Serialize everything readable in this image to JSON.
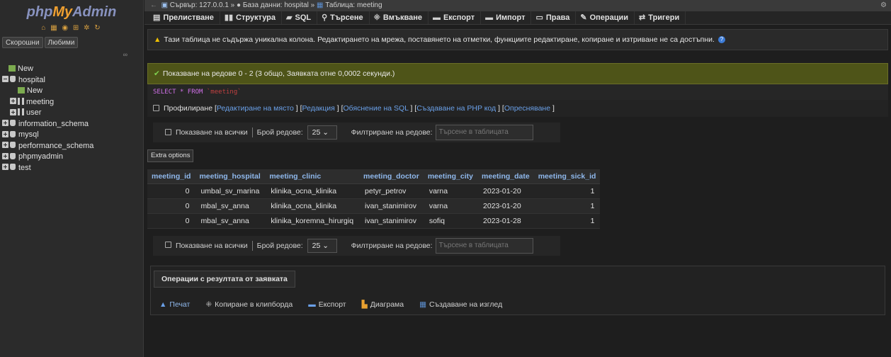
{
  "app": {
    "logo_php": "php",
    "logo_my": "My",
    "logo_admin": "Admin",
    "logo_icons": "⌂ ▦ ◉ ⊞ ✲ ↻"
  },
  "sidebar": {
    "tabs": [
      "Скорошни",
      "Любими"
    ],
    "link_icon": "∞",
    "tree": [
      {
        "label": "New",
        "level": 0,
        "type": "new"
      },
      {
        "label": "hospital",
        "level": 0,
        "type": "db",
        "expanded": true
      },
      {
        "label": "New",
        "level": 1,
        "type": "new"
      },
      {
        "label": "meeting",
        "level": 1,
        "type": "table"
      },
      {
        "label": "user",
        "level": 1,
        "type": "table"
      },
      {
        "label": "information_schema",
        "level": 0,
        "type": "db"
      },
      {
        "label": "mysql",
        "level": 0,
        "type": "db"
      },
      {
        "label": "performance_schema",
        "level": 0,
        "type": "db"
      },
      {
        "label": "phpmyadmin",
        "level": 0,
        "type": "db"
      },
      {
        "label": "test",
        "level": 0,
        "type": "db"
      }
    ]
  },
  "breadcrumb": {
    "server": "Сървър: 127.0.0.1",
    "database": "База данни: hospital",
    "table": "Таблица: meeting",
    "arrow": "»"
  },
  "tabs": [
    {
      "label": "Прелистване",
      "icon": "browse-icon"
    },
    {
      "label": "Структура",
      "icon": "structure-icon"
    },
    {
      "label": "SQL",
      "icon": "sql-icon"
    },
    {
      "label": "Търсене",
      "icon": "search-icon"
    },
    {
      "label": "Вмъкване",
      "icon": "insert-icon"
    },
    {
      "label": "Експорт",
      "icon": "export-icon"
    },
    {
      "label": "Импорт",
      "icon": "import-icon"
    },
    {
      "label": "Права",
      "icon": "privileges-icon"
    },
    {
      "label": "Операции",
      "icon": "operations-icon"
    },
    {
      "label": "Тригери",
      "icon": "triggers-icon"
    }
  ],
  "warning": "Тази таблица не съдържа уникална колона. Редактирането на мрежа, поставянето на отметки, функциите редактиране, копиране и изтриване не са достъпни.",
  "success": "Показване на редове 0 - 2 (3 общо, Заявката отне 0,0002 секунди.)",
  "sql": {
    "select": "SELECT",
    "star": "*",
    "from": "FROM",
    "table": "`meeting`"
  },
  "profiling": {
    "label": "Профилиране",
    "links": [
      "Редактиране на място",
      "Редакция",
      "Обяснение на SQL",
      "Създаване на PHP код",
      "Опресняване"
    ]
  },
  "nav": {
    "show_all": "Показване на всички",
    "rows_label": "Брой редове:",
    "rows_value": "25",
    "filter_label": "Филтриране на редове:",
    "filter_placeholder": "Търсене в таблицата"
  },
  "extra_options": "Extra options",
  "table": {
    "columns": [
      "meeting_id",
      "meeting_hospital",
      "meeting_clinic",
      "meeting_doctor",
      "meeting_city",
      "meeting_date",
      "meeting_sick_id"
    ],
    "rows": [
      [
        "0",
        "umbal_sv_marina",
        "klinika_ocna_klinika",
        "petyr_petrov",
        "varna",
        "2023-01-20",
        "1"
      ],
      [
        "0",
        "mbal_sv_anna",
        "klinika_ocna_klinika",
        "ivan_stanimirov",
        "varna",
        "2023-01-20",
        "1"
      ],
      [
        "0",
        "mbal_sv_anna",
        "klinika_koremna_hirurgiq",
        "ivan_stanimirov",
        "sofiq",
        "2023-01-28",
        "1"
      ]
    ]
  },
  "ops": {
    "title": "Операции с резултата от заявката",
    "links": [
      {
        "label": "Печат",
        "icon": "print-icon"
      },
      {
        "label": "Копиране в клипборда",
        "icon": "clipboard-icon"
      },
      {
        "label": "Експорт",
        "icon": "export-icon"
      },
      {
        "label": "Диаграма",
        "icon": "chart-icon"
      },
      {
        "label": "Създаване на изглед",
        "icon": "view-icon"
      }
    ]
  },
  "colors": {
    "link": "#8fb8ec",
    "warning": "#f0c000",
    "success_bg": "#4e5418",
    "sql_keyword": "#d070e8"
  }
}
